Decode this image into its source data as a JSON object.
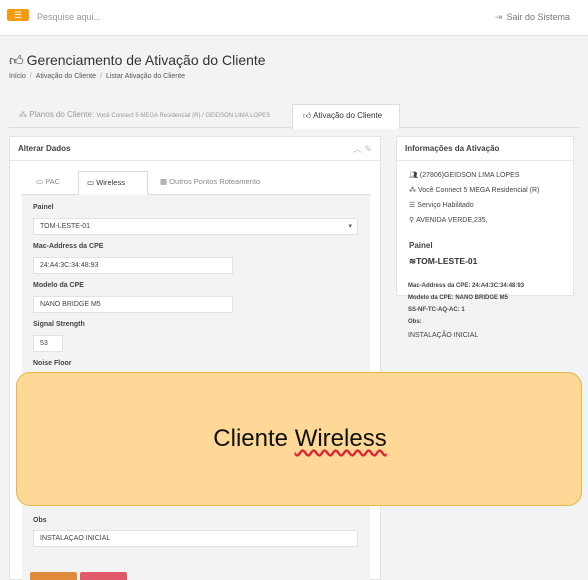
{
  "topbar": {
    "menu_icon": "bars-icon",
    "search_placeholder": "Pesquise aqui...",
    "logout_label": "Sair do Sistema"
  },
  "page": {
    "title": "Gerenciamento de Ativação do Cliente",
    "breadcrumb": [
      "Início",
      "Ativação do Cliente",
      "Listar Ativação do Cliente"
    ]
  },
  "main_tabs": {
    "plans_prefix": "Planos do Cliente:",
    "plans_detail": "Você Connect 5 MEGA Residencial (R) / GEIDSON LIMA LOPES",
    "activation": "Ativação do Cliente"
  },
  "left_panel": {
    "title": "Alterar Dados",
    "tabs": [
      "PAC",
      "Wireless",
      "Outros Pontos Roteamento"
    ],
    "fields": {
      "painel_label": "Painel",
      "painel_value": "TOM-LESTE-01",
      "mac_label": "Mac-Address da CPE",
      "mac_value": "24:A4:3C:34:48:93",
      "modelo_label": "Modelo da CPE",
      "modelo_value": "NANO BRIDGE M5",
      "signal_label": "Signal Strength",
      "signal_value": "53",
      "noise_label": "Noise Floor",
      "obs_label": "Obs",
      "obs_value": "INSTALAÇAO INICIAL"
    }
  },
  "right_panel": {
    "title": "Informações da Ativação",
    "client": "(27806)GEIDSON LIMA LOPES",
    "plan": "Você Connect 5 MEGA Residencial (R)",
    "service": "Serviço Habilitado",
    "address": "AVENIDA VERDE,235,",
    "painel_label": "Painel",
    "painel_value": "TOM-LESTE-01",
    "mac_line": "Mac-Address da CPE: 24:A4:3C:34:48:93",
    "modelo_line": "Modelo da CPE: NANO BRIDGE M5",
    "ss_line": "SS-NF-TC-AQ-AC: 1",
    "obs_label": "Obs:",
    "obs_value": "INSTALAÇÃO INICIAL"
  },
  "callout": {
    "word1": "Cliente",
    "word2": "Wireless"
  },
  "colors": {
    "accent": "#f39c12",
    "callout_bg": "#fdd897",
    "button_orange": "#e08a3c",
    "button_red": "#e05a6a"
  }
}
